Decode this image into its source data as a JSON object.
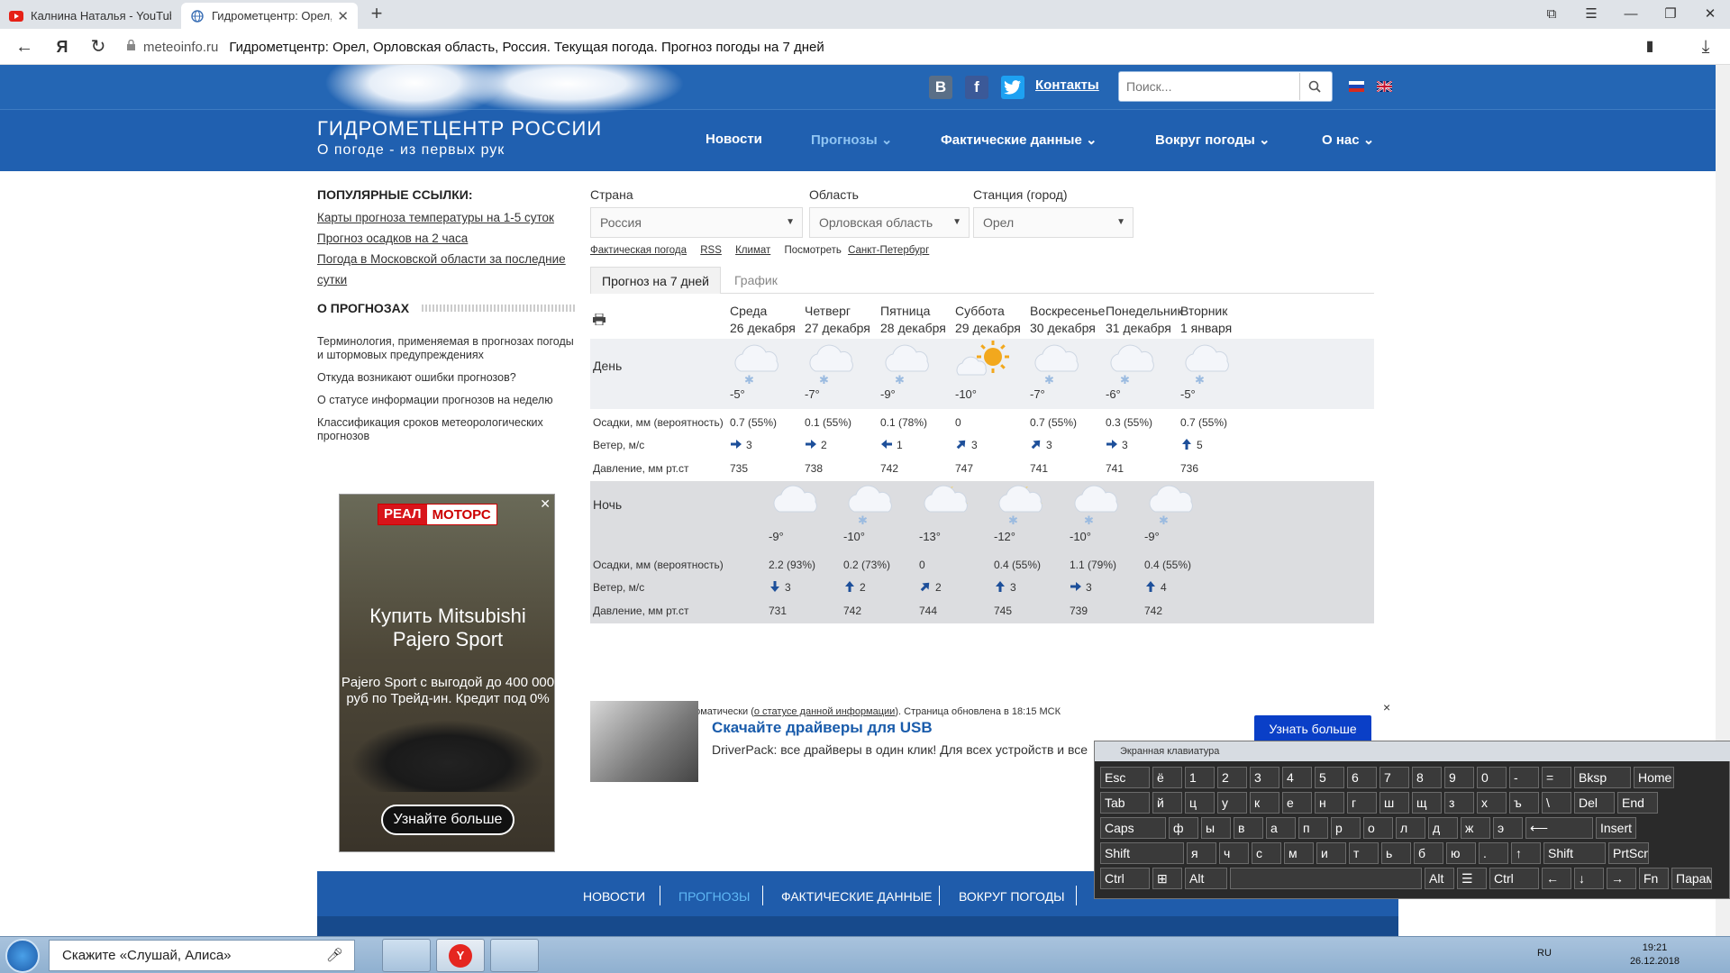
{
  "browser": {
    "tabs": [
      {
        "title": "Калнина Наталья - YouTube",
        "icon": "youtube-icon"
      },
      {
        "title": "Гидрометцентр: Орел, Ор",
        "icon": "globe-icon",
        "active": true
      }
    ],
    "new_tab": "+",
    "url_domain": "meteoinfo.ru",
    "url_title": "Гидрометцентр: Орел, Орловская область, Россия. Текущая погода. Прогноз погоды на 7 дней"
  },
  "site": {
    "contacts": "Контакты",
    "search_placeholder": "Поиск...",
    "brand_title": "ГИДРОМЕТЦЕНТР РОССИИ",
    "brand_subtitle": "О погоде - из первых рук",
    "nav": [
      {
        "label": "Новости"
      },
      {
        "label": "Прогнозы"
      },
      {
        "label": "Фактические данные"
      },
      {
        "label": "Вокруг погоды"
      },
      {
        "label": "О нас"
      }
    ]
  },
  "sidebar": {
    "popular_title": "ПОПУЛЯРНЫЕ ССЫЛКИ:",
    "popular_links": [
      "Карты прогноза температуры на 1-5 суток",
      "Прогноз осадков на 2 часа",
      "Погода в Московской области за последние",
      "сутки"
    ],
    "about_title": "О ПРОГНОЗАХ",
    "about_links": [
      "Терминология, применяемая в прогнозах погоды и штормовых предупреждениях",
      "Откуда возникают ошибки прогнозов?",
      "О статусе информации прогнозов на неделю",
      "Классификация сроков метеорологических прогнозов"
    ]
  },
  "ad_left": {
    "brand_a": "РЕАЛ",
    "brand_b": "МОТОРС",
    "headline": "Купить Mitsubishi Pajero Sport",
    "text": "Pajero Sport с выгодой до 400 000 руб по Трейд-ин. Кредит под 0%",
    "button": "Узнайте больше"
  },
  "selectors": {
    "country_label": "Страна",
    "country_value": "Россия",
    "region_label": "Область",
    "region_value": "Орловская область",
    "station_label": "Станция (город)",
    "station_value": "Орел"
  },
  "sublinks": {
    "actual": "Фактическая погода",
    "rss": "RSS",
    "climate": "Климат",
    "see": "Посмотреть",
    "spb": "Санкт-Петербург"
  },
  "forecast_tabs": [
    "Прогноз на 7 дней",
    "График"
  ],
  "forecast": {
    "days": [
      {
        "name": "Среда",
        "date": "26 декабря"
      },
      {
        "name": "Четверг",
        "date": "27 декабря"
      },
      {
        "name": "Пятница",
        "date": "28 декабря"
      },
      {
        "name": "Суббота",
        "date": "29 декабря"
      },
      {
        "name": "Воскресенье",
        "date": "30 декабря"
      },
      {
        "name": "Понедельник",
        "date": "31 декабря"
      },
      {
        "name": "Вторник",
        "date": "1 января"
      }
    ],
    "day_label": "День",
    "night_label": "Ночь",
    "row_precip": "Осадки, мм (вероятность)",
    "row_wind": "Ветер, м/с",
    "row_pressure": "Давление, мм рт.ст",
    "day": {
      "icons": [
        "cloud-snow-icon",
        "cloud-snow-icon",
        "cloud-snow-icon",
        "sun-cloud-icon",
        "cloud-snow-icon",
        "cloud-snow-icon",
        "cloud-snow-icon"
      ],
      "temps": [
        "-5°",
        "-7°",
        "-9°",
        "-10°",
        "-7°",
        "-6°",
        "-5°"
      ],
      "precip": [
        "0.7 (55%)",
        "0.1 (55%)",
        "0.1 (78%)",
        "0",
        "0.7 (55%)",
        "0.3 (55%)",
        "0.7 (55%)"
      ],
      "wind_dirs": [
        "east",
        "east",
        "west",
        "north-east",
        "north-east",
        "east",
        "north"
      ],
      "wind": [
        "3",
        "2",
        "1",
        "3",
        "3",
        "3",
        "5"
      ],
      "pressure": [
        "735",
        "738",
        "742",
        "747",
        "741",
        "741",
        "736"
      ]
    },
    "night": {
      "icons": [
        "cloud-icon",
        "cloud-snow-icon",
        "moon-cloud-icon",
        "moon-cloud-snow-icon",
        "cloud-snow-icon",
        "cloud-snow-icon"
      ],
      "temps": [
        "-9°",
        "-10°",
        "-13°",
        "-12°",
        "-10°",
        "-9°"
      ],
      "precip": [
        "2.2 (93%)",
        "0.2 (73%)",
        "0",
        "0.4 (55%)",
        "1.1 (79%)",
        "0.4 (55%)"
      ],
      "wind_dirs": [
        "south",
        "north",
        "north-east",
        "north",
        "east",
        "north"
      ],
      "wind": [
        "3",
        "2",
        "2",
        "3",
        "3",
        "4"
      ],
      "pressure": [
        "731",
        "742",
        "744",
        "745",
        "739",
        "742"
      ]
    }
  },
  "note": {
    "a": "Прогноз рассчитан автоматически (",
    "link": "о статусе данной информации",
    "b": "). Страница обновлена в 18:15 МСК"
  },
  "ad_bottom": {
    "title": "Скачайте драйверы для USB",
    "text": "DriverPack: все драйверы в один клик! Для всех устройств и все",
    "button": "Узнать больше",
    "close": "×"
  },
  "footer": {
    "links": [
      "НОВОСТИ",
      "ПРОГНОЗЫ",
      "ФАКТИЧЕСКИЕ ДАННЫЕ",
      "ВОКРУГ ПОГОДЫ"
    ]
  },
  "osk": {
    "title": "Экранная клавиатура",
    "rows": [
      [
        "Esc",
        "ё",
        "1",
        "2",
        "3",
        "4",
        "5",
        "6",
        "7",
        "8",
        "9",
        "0",
        "-",
        "=",
        "Bksp",
        "Home"
      ],
      [
        "Tab",
        "й",
        "ц",
        "у",
        "к",
        "е",
        "н",
        "г",
        "ш",
        "щ",
        "з",
        "х",
        "ъ",
        "\\",
        "Del",
        "End"
      ],
      [
        "Caps",
        "ф",
        "ы",
        "в",
        "а",
        "п",
        "р",
        "о",
        "л",
        "д",
        "ж",
        "э",
        "⟵",
        "Insert"
      ],
      [
        "Shift",
        "я",
        "ч",
        "с",
        "м",
        "и",
        "т",
        "ь",
        "б",
        "ю",
        ".",
        "↑",
        "Shift",
        "PrtScn"
      ],
      [
        "Ctrl",
        "⊞",
        "Alt",
        "",
        "Alt",
        "☰",
        "Ctrl",
        "←",
        "↓",
        "→",
        "Fn",
        "Параметры"
      ]
    ]
  },
  "taskbar": {
    "alice": "Скажите «Слушай, Алиса»",
    "lang": "RU",
    "time": "19:21",
    "date": "26.12.2018"
  }
}
